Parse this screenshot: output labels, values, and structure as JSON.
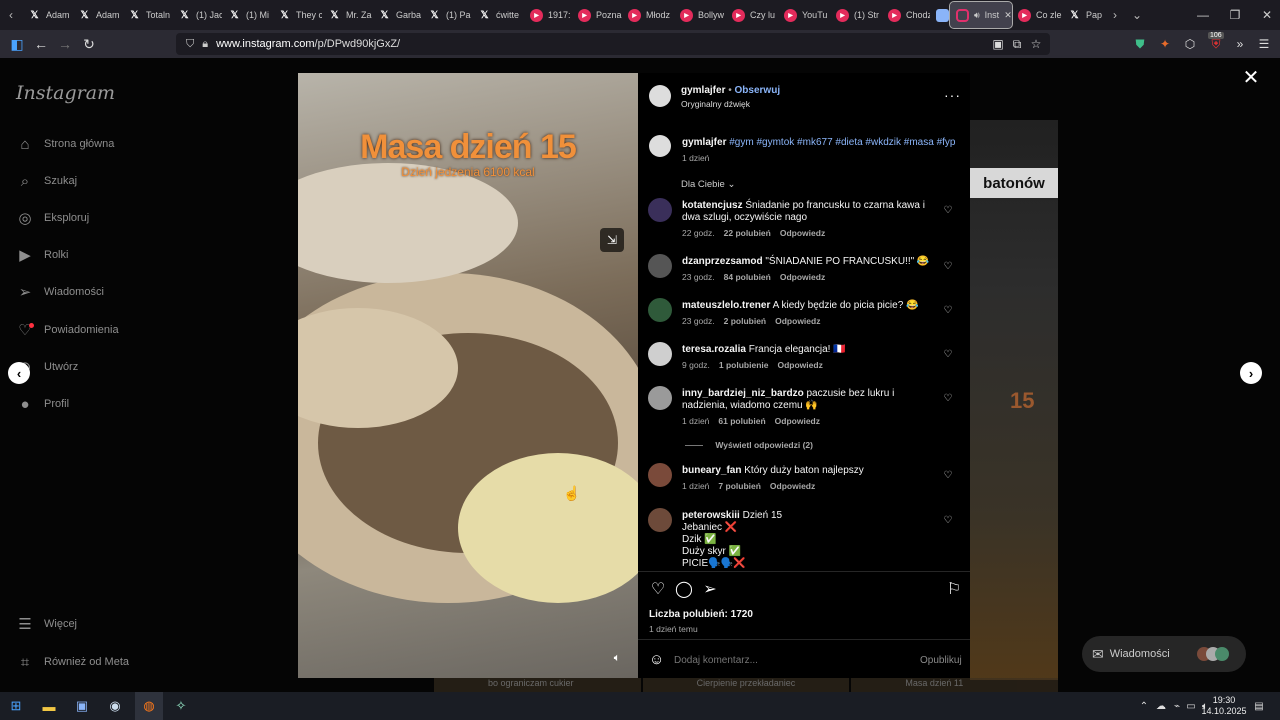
{
  "browser": {
    "tabs": [
      {
        "label": "Adam",
        "favicon": "x-icon"
      },
      {
        "label": "Adam",
        "favicon": "x-icon"
      },
      {
        "label": "Totaln",
        "favicon": "x-icon"
      },
      {
        "label": "(1) Jac",
        "favicon": "x-icon"
      },
      {
        "label": "(1) Mi",
        "favicon": "x-icon"
      },
      {
        "label": "They c",
        "favicon": "x-icon"
      },
      {
        "label": "Mr. Za",
        "favicon": "x-icon"
      },
      {
        "label": "Garba",
        "favicon": "x-icon"
      },
      {
        "label": "(1) Pa",
        "favicon": "x-icon"
      },
      {
        "label": "ćwitte",
        "favicon": "x-icon"
      },
      {
        "label": "1917:",
        "favicon": "youtube-icon"
      },
      {
        "label": "Pozna",
        "favicon": "youtube-icon"
      },
      {
        "label": "Młodz",
        "favicon": "youtube-icon"
      },
      {
        "label": "Bollyw",
        "favicon": "youtube-icon"
      },
      {
        "label": "Czy lu",
        "favicon": "youtube-icon"
      },
      {
        "label": "YouTu",
        "favicon": "youtube-icon"
      },
      {
        "label": "(1) Str",
        "favicon": "youtube-icon"
      },
      {
        "label": "Chodz",
        "favicon": "youtube-icon"
      }
    ],
    "active_tab_label": "Inst",
    "after_tabs": [
      {
        "label": "Co zle",
        "favicon": "youtube-icon"
      },
      {
        "label": "Pap",
        "favicon": "x-icon"
      }
    ],
    "url_host": "www.instagram.com",
    "url_path": "/p/DPwd90kjGxZ/",
    "badge_count": "106"
  },
  "sidebar": {
    "logo": "Instagram",
    "items": [
      {
        "label": "Strona główna",
        "icon": "home-icon"
      },
      {
        "label": "Szukaj",
        "icon": "search-icon"
      },
      {
        "label": "Eksploruj",
        "icon": "compass-icon"
      },
      {
        "label": "Rolki",
        "icon": "reels-icon"
      },
      {
        "label": "Wiadomości",
        "icon": "send-icon"
      },
      {
        "label": "Powiadomienia",
        "icon": "heart-icon"
      },
      {
        "label": "Utwórz",
        "icon": "plus-icon"
      },
      {
        "label": "Profil",
        "icon": "avatar-icon"
      }
    ],
    "more": "Więcej",
    "meta": "Również od Meta"
  },
  "background": {
    "card_label": "batonów",
    "card_number": "15",
    "thumb_text_1": "bo ograniczam cukier",
    "thumb_text_2": "Cierpienie przekładaniec",
    "thumb_text_3": "Masa dzień 11"
  },
  "media": {
    "title": "Masa dzień 15",
    "subtitle": "Dzień jedzenia 6100 kcal"
  },
  "post": {
    "author": "gymlajfer",
    "follow": "Obserwuj",
    "audio": "Oryginalny dźwięk",
    "caption_user": "gymlajfer",
    "caption_tags": "#gym #gymtok #mk677 #dieta #wkdzik #masa #fyp",
    "caption_time": "1 dzień",
    "filter": "Dla Ciebie",
    "comments": [
      {
        "user": "kotatencjusz",
        "text": "Śniadanie po francusku to czarna kawa i dwa szlugi, oczywiście nago",
        "time": "22 godz.",
        "likes": "22 polubień",
        "reply": "Odpowiedz"
      },
      {
        "user": "dzanprzezsamod",
        "text": "\"ŚNIADANIE PO FRANCUSKU!!\" 😂",
        "time": "23 godz.",
        "likes": "84 polubień",
        "reply": "Odpowiedz"
      },
      {
        "user": "mateuszlelo.trener",
        "text": "A kiedy będzie do picia picie? 😂",
        "time": "23 godz.",
        "likes": "2 polubień",
        "reply": "Odpowiedz"
      },
      {
        "user": "teresa.rozalia",
        "text": "Francja elegancja! 🇫🇷",
        "time": "9 godz.",
        "likes": "1 polubienie",
        "reply": "Odpowiedz"
      },
      {
        "user": "inny_bardziej_niz_bardzo",
        "text": "paczusie bez lukru i nadzienia, wiadomo czemu 🙌",
        "time": "1 dzień",
        "likes": "61 polubień",
        "reply": "Odpowiedz"
      },
      {
        "user": "buneary_fan",
        "text": "Który duży baton najlepszy",
        "time": "1 dzień",
        "likes": "7 polubień",
        "reply": "Odpowiedz"
      }
    ],
    "view_replies": "Wyświetl odpowiedzi (2)",
    "last_comment_user": "peterowskiii",
    "last_comment_lines": [
      "Dzień 15",
      "Jebaniec ❌",
      "Dzik ✅",
      "Duży skyr ✅",
      "PICIE🗣️🗣️❌"
    ],
    "likes_label": "Liczba polubień: 1720",
    "posted": "1 dzień temu",
    "add_comment_placeholder": "Dodaj komentarz...",
    "publish": "Opublikuj"
  },
  "messages_pill": "Wiadomości",
  "clock": {
    "time": "19:30",
    "date": "14.10.2025"
  }
}
